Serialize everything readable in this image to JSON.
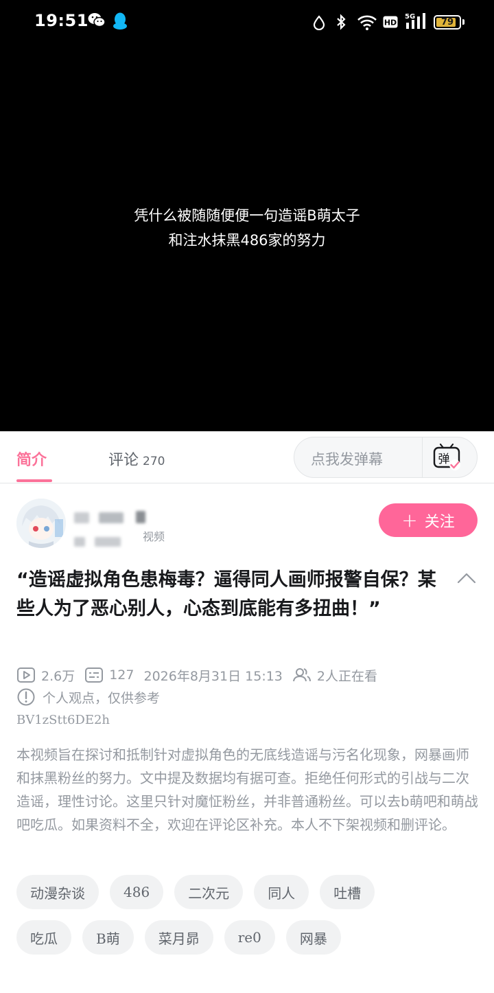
{
  "status_bar": {
    "time": "19:51",
    "battery": "79"
  },
  "video": {
    "subtitle_line1": "凭什么被随随便便一句造谣B萌太子",
    "subtitle_line2": "和注水抹黑486家的努力"
  },
  "tabs": {
    "intro": "简介",
    "comments": "评论",
    "comments_count": "270",
    "danmu_placeholder": "点我发弹幕"
  },
  "author": {
    "subtitle": "视频",
    "follow_label": "关注"
  },
  "video_info": {
    "title": "“造谣虚拟角色患梅毒？逼得同人画师报警自保？某些人为了恶心别人，心态到底能有多扭曲！”",
    "views": "2.6万",
    "danmaku_count": "127",
    "publish_time": "2026年8月31日 15:13",
    "watching": "2人正在看",
    "note": "个人观点，仅供参考",
    "bvid": "BV1zStt6DE2h",
    "description": "本视频旨在探讨和抵制针对虚拟角色的无底线造谣与污名化现象，网暴画师和抹黑粉丝的努力。文中提及数据均有据可查。拒绝任何形式的引战与二次造谣，理性讨论。这里只针对魔怔粉丝，并非普通粉丝。可以去b萌吧和萌战吧吃瓜。如果资料不全，欢迎在评论区补充。本人不下架视频和删评论。"
  },
  "tags_row1": [
    "动漫杂谈",
    "486",
    "二次元",
    "同人",
    "吐槽"
  ],
  "tags_row2": [
    "吃瓜",
    "B萌",
    "菜月昴",
    "re0",
    "网暴"
  ],
  "colors": {
    "accent": "#fb7299",
    "follow": "#ff6699",
    "muted": "#9499a0"
  }
}
